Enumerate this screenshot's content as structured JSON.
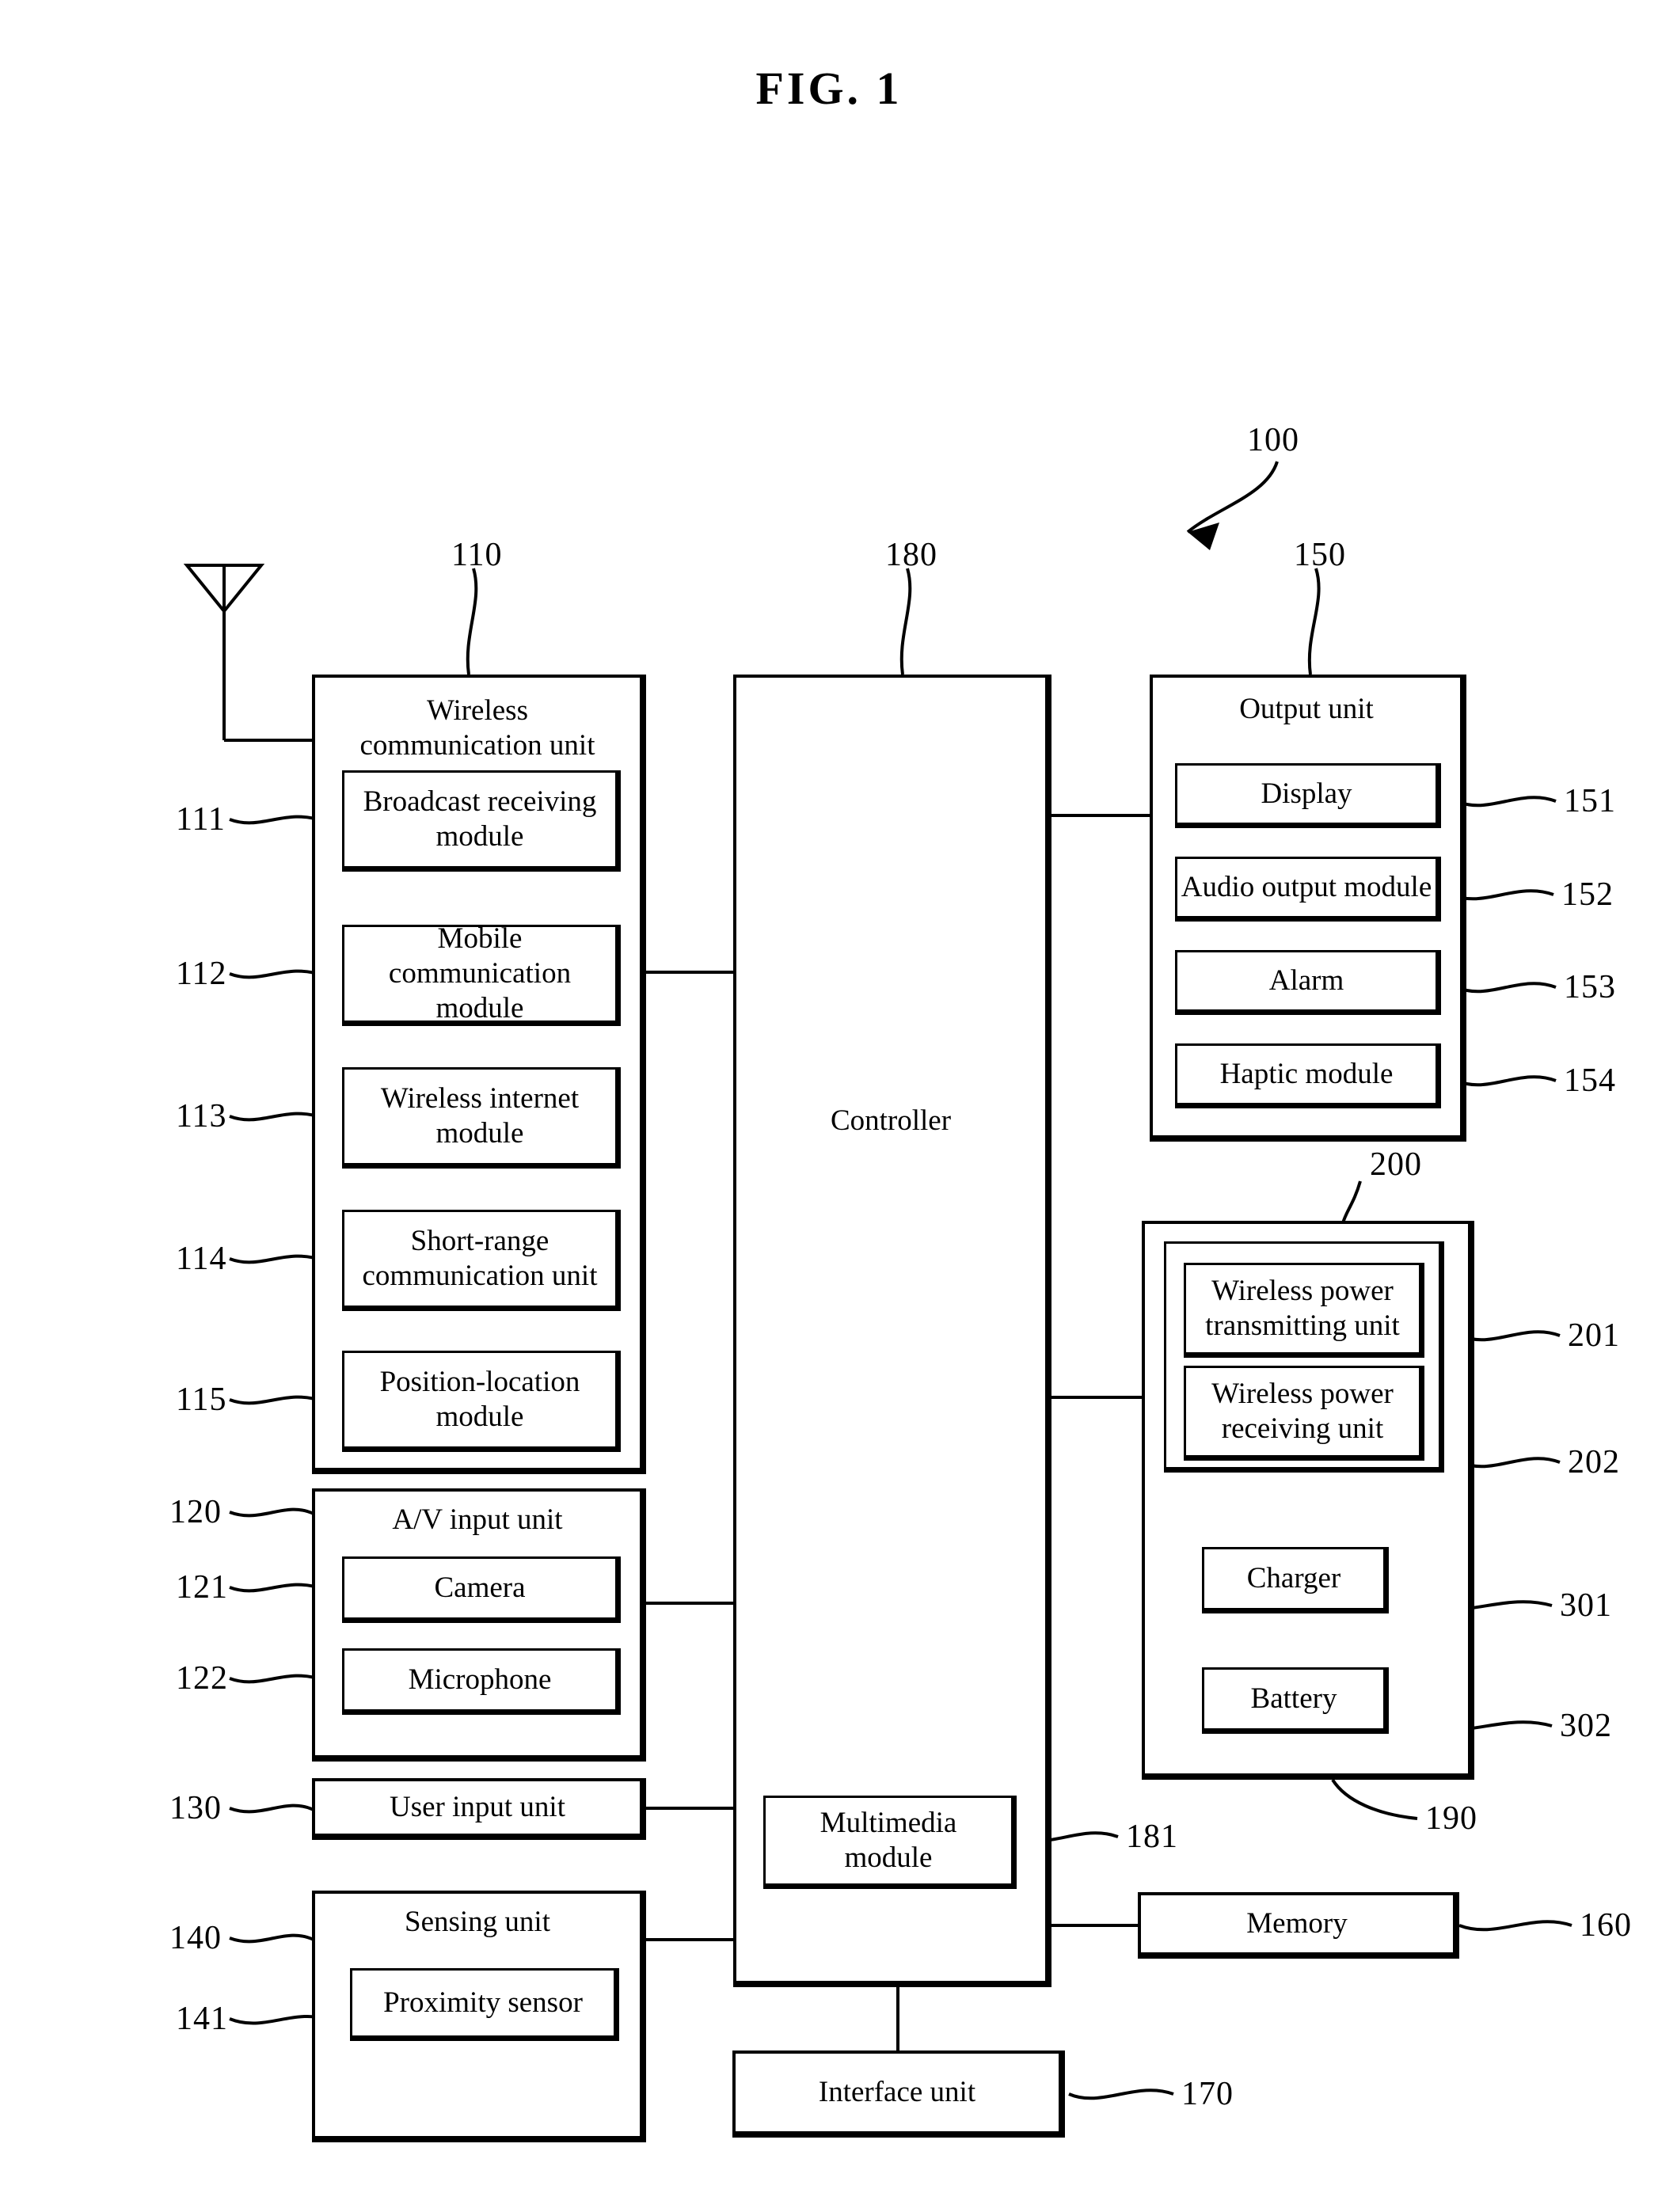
{
  "figure": {
    "title": "FIG. 1"
  },
  "refs": {
    "r100": "100",
    "r110": "110",
    "r111": "111",
    "r112": "112",
    "r113": "113",
    "r114": "114",
    "r115": "115",
    "r120": "120",
    "r121": "121",
    "r122": "122",
    "r130": "130",
    "r140": "140",
    "r141": "141",
    "r150": "150",
    "r151": "151",
    "r152": "152",
    "r153": "153",
    "r154": "154",
    "r160": "160",
    "r170": "170",
    "r180": "180",
    "r181": "181",
    "r190": "190",
    "r200": "200",
    "r201": "201",
    "r202": "202",
    "r301": "301",
    "r302": "302"
  },
  "blocks": {
    "wireless_communication_unit": "Wireless\ncommunication unit",
    "broadcast_receiving_module": "Broadcast receiving\nmodule",
    "mobile_communication_module": "Mobile communication\nmodule",
    "wireless_internet_module": "Wireless internet\nmodule",
    "short_range_communication_unit": "Short-range\ncommunication unit",
    "position_location_module": "Position-location\nmodule",
    "av_input_unit": "A/V input unit",
    "camera": "Camera",
    "microphone": "Microphone",
    "user_input_unit": "User input unit",
    "sensing_unit": "Sensing unit",
    "proximity_sensor": "Proximity sensor",
    "controller": "Controller",
    "multimedia_module": "Multimedia\nmodule",
    "interface_unit": "Interface unit",
    "output_unit": "Output unit",
    "display": "Display",
    "audio_output_module": "Audio output module",
    "alarm": "Alarm",
    "haptic_module": "Haptic module",
    "wireless_power_transmitting_unit": "Wireless power\ntransmitting unit",
    "wireless_power_receiving_unit": "Wireless power\nreceiving unit",
    "charger": "Charger",
    "battery": "Battery",
    "memory": "Memory"
  }
}
